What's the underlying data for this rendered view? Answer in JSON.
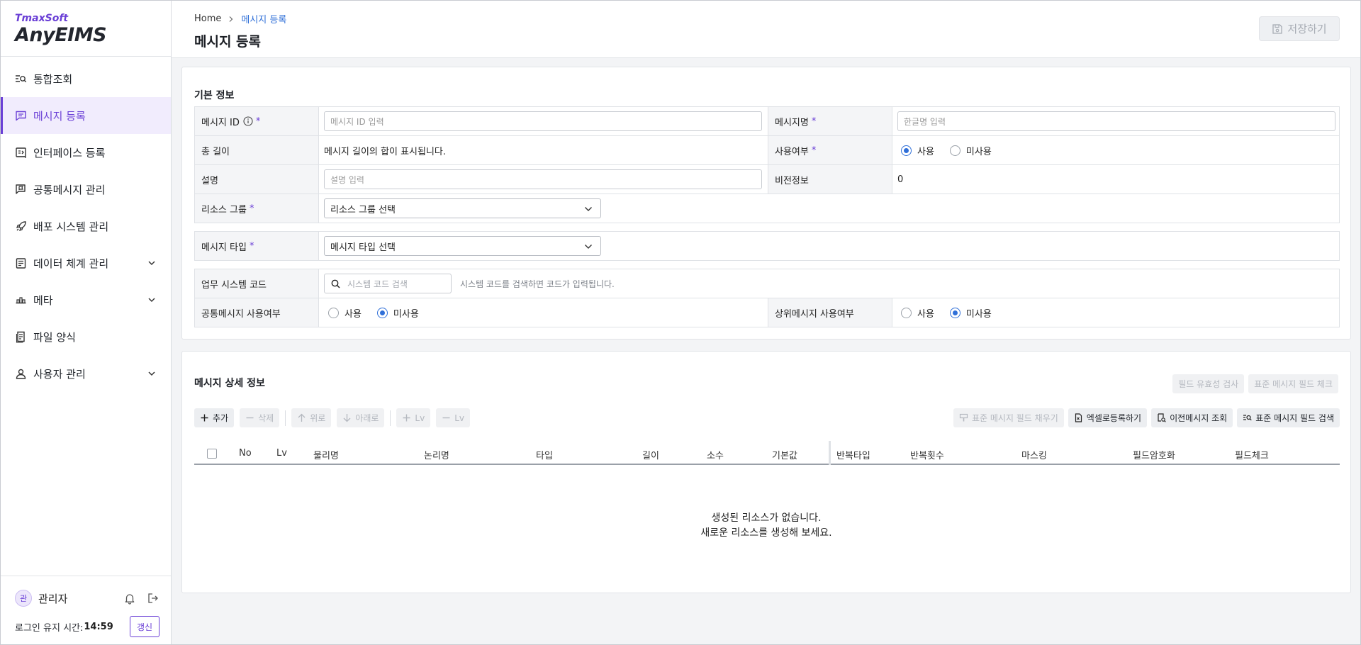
{
  "brand": {
    "company": "TmaxSoft",
    "product": "AnyEIMS"
  },
  "sidebar": {
    "items": [
      {
        "label": "통합조회",
        "icon": "search-list-icon",
        "active": false,
        "expandable": false
      },
      {
        "label": "메시지 등록",
        "icon": "message-icon",
        "active": true,
        "expandable": false
      },
      {
        "label": "인터페이스 등록",
        "icon": "interface-icon",
        "active": false,
        "expandable": false
      },
      {
        "label": "공통메시지 관리",
        "icon": "flag-message-icon",
        "active": false,
        "expandable": false
      },
      {
        "label": "배포 시스템 관리",
        "icon": "rocket-icon",
        "active": false,
        "expandable": false
      },
      {
        "label": "데이터 체계 관리",
        "icon": "document-icon",
        "active": false,
        "expandable": true
      },
      {
        "label": "메타",
        "icon": "meta-icon",
        "active": false,
        "expandable": true
      },
      {
        "label": "파일 양식",
        "icon": "file-icon",
        "active": false,
        "expandable": false
      },
      {
        "label": "사용자 관리",
        "icon": "user-icon",
        "active": false,
        "expandable": true
      }
    ],
    "footer": {
      "avatar_text": "관",
      "user_name": "관리자",
      "session_label": "로그인 유지 시간:",
      "session_time": "14:59",
      "renew_label": "갱신"
    }
  },
  "header": {
    "breadcrumb": {
      "home": "Home",
      "current": "메시지 등록"
    },
    "title": "메시지 등록",
    "save_label": "저장하기"
  },
  "basic": {
    "title": "기본 정보",
    "message_id": {
      "label": "메시지 ID",
      "placeholder": "메시지 ID 입력"
    },
    "message_name": {
      "label": "메시지명",
      "placeholder": "한글명 입력"
    },
    "total_length": {
      "label": "총 길이",
      "value": "메시지 길이의 합이 표시됩니다."
    },
    "use_yn": {
      "label": "사용여부",
      "options": [
        "사용",
        "미사용"
      ],
      "selected": "사용"
    },
    "description": {
      "label": "설명",
      "placeholder": "설명 입력"
    },
    "version": {
      "label": "비전정보",
      "value": "0"
    },
    "resource_group": {
      "label": "리소스 그룹",
      "value": "리소스 그룹 선택"
    },
    "message_type": {
      "label": "메시지 타입",
      "value": "메시지 타입 선택"
    },
    "system_code": {
      "label": "업무 시스템 코드",
      "placeholder": "시스템 코드 검색",
      "hint": "시스템 코드를 검색하면 코드가 입력됩니다."
    },
    "common_use": {
      "label": "공통메시지 사용여부",
      "options": [
        "사용",
        "미사용"
      ],
      "selected": "미사용"
    },
    "parent_use": {
      "label": "상위메시지 사용여부",
      "options": [
        "사용",
        "미사용"
      ],
      "selected": "미사용"
    },
    "required_mark": "*"
  },
  "detail": {
    "title": "메시지 상세 정보",
    "top_buttons": [
      "필드 유효성 검사",
      "표준 메시지 필드 체크"
    ],
    "toolbar_left": {
      "add": "추가",
      "delete": "삭제",
      "up": "위로",
      "down": "아래로",
      "lv_plus": "Lv",
      "lv_minus": "Lv"
    },
    "toolbar_right": {
      "fill_std": "표준 메시지 필드 채우기",
      "excel": "엑셀로등록하기",
      "prev": "이전메시지 조회",
      "search_std": "표준 메시지 필드 검색"
    },
    "columns": [
      "No",
      "Lv",
      "물리명",
      "논리명",
      "타입",
      "길이",
      "소수",
      "기본값",
      "반복타입",
      "반복횟수",
      "마스킹",
      "필드암호화",
      "필드체크"
    ],
    "empty_line1": "생성된 리소스가 없습니다.",
    "empty_line2": "새로운 리소스를 생성해 보세요."
  },
  "colors": {
    "accent": "#6a3fd6",
    "link": "#2f6fd8",
    "radio": "#2f6fd8"
  }
}
